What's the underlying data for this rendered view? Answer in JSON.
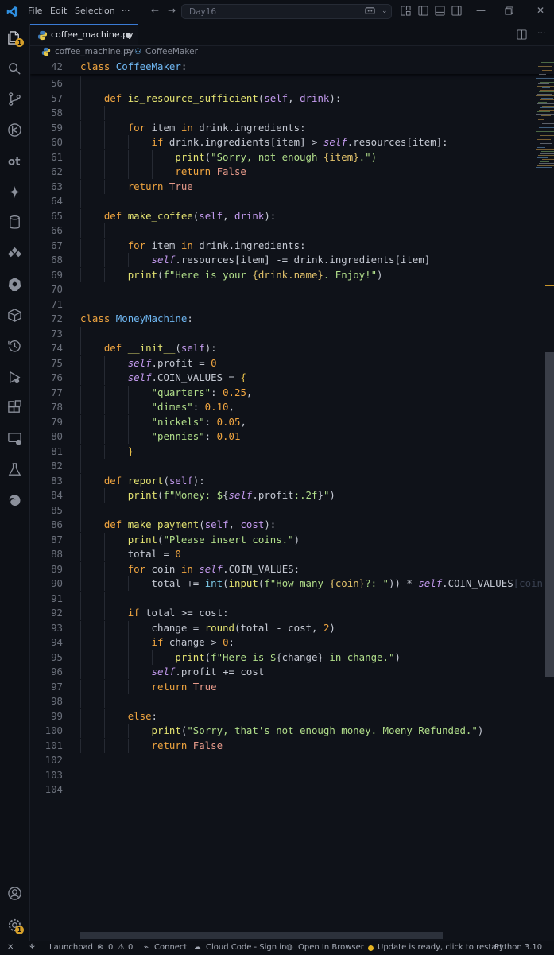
{
  "titlebar": {
    "menu": [
      "File",
      "Edit",
      "Selection"
    ],
    "more": "···",
    "search_text": "Day16"
  },
  "activity_bar": {
    "explorer_badge": "1",
    "manage_badge": "1",
    "icons": [
      "explorer-icon",
      "search-icon",
      "source-control-icon",
      "run-debug-icon",
      "outline-icon",
      "copilot-icon",
      "database-icon",
      "extensions-icon",
      "kubernetes-icon",
      "packages-icon",
      "timeline-icon",
      "deploy-icon",
      "extensions-grid-icon",
      "remote-explorer-icon",
      "testing-icon",
      "edge-icon",
      "account-icon",
      "manage-icon"
    ]
  },
  "tab": {
    "filename": "coffee_machine.py",
    "dirty": true
  },
  "breadcrumb": {
    "file": "coffee_machine.py",
    "symbol": "CoffeeMaker",
    "separator": ">"
  },
  "editor": {
    "sticky_line": "42",
    "sticky_text": {
      "kw": "class",
      "name": "CoffeeMaker",
      "colon": ":"
    },
    "line_numbers": [
      "56",
      "57",
      "58",
      "59",
      "60",
      "61",
      "62",
      "63",
      "64",
      "65",
      "66",
      "67",
      "68",
      "69",
      "70",
      "71",
      "72",
      "73",
      "74",
      "75",
      "76",
      "77",
      "78",
      "79",
      "80",
      "81",
      "82",
      "83",
      "84",
      "85",
      "86",
      "87",
      "88",
      "89",
      "90",
      "91",
      "92",
      "93",
      "94",
      "95",
      "96",
      "97",
      "98",
      "99",
      "100",
      "101",
      "102",
      "103",
      "104"
    ],
    "tokens": {
      "def": "def",
      "class": "class",
      "for": "for",
      "in": "in",
      "if": "if",
      "return": "return",
      "else": "else",
      "self": "self",
      "True": "True",
      "False": "False",
      "print": "print",
      "is_resource_sufficient": "is_resource_sufficient",
      "make_coffee": "make_coffee",
      "MoneyMachine": "MoneyMachine",
      "__init__": "__init__",
      "report": "report",
      "make_payment": "make_payment",
      "int": "int",
      "input": "input",
      "round": "round",
      "drink": "drink",
      "item": "item",
      "ingredients": "ingredients",
      "resources": "resources",
      "profit": "profit",
      "COIN_VALUES": "COIN_VALUES",
      "cost": "cost",
      "total": "total",
      "coin": "coin",
      "change": "change",
      "name": "name",
      "str_sorry": "\"Sorry, not enough ",
      "str_item": "{item}",
      "str_end": ".\")",
      "str_here": "f\"Here is your ",
      "str_drinkname": "{drink.name}",
      "str_enjoy": ". Enjoy!\"",
      "quarters": "\"quarters\"",
      "dimes": "\"dimes\"",
      "nickels": "\"nickels\"",
      "pennies": "\"pennies\"",
      "n025": "0.25",
      "n010": "0.10",
      "n005": "0.05",
      "n001": "0.01",
      "n0": "0",
      "n2": "2",
      "str_money": "f\"Money: $",
      "str_profit_fmt": ":.2f",
      "str_close": "\"",
      "str_insert": "\"Please insert coins.\"",
      "str_howmany": "f\"How many ",
      "str_coin": "{coin}",
      "str_howmany_end": "?: \"",
      "str_here_is": "f\"Here is $",
      "str_change": "change",
      "str_in_change": " in change.\"",
      "str_refund": "\"Sorry, that's not enough money. Moeny Refunded.\"",
      "trail_coin": "[coin"
    }
  },
  "statusbar": {
    "launchpad": "Launchpad",
    "errors": "0",
    "warnings": "0",
    "connect": "Connect",
    "cloud_code": "Cloud Code - Sign in",
    "open_browser": "Open In Browser",
    "update": "Update is ready, click to restart.",
    "python": "Python 3.10"
  },
  "colors": {
    "accent": "#3a7bd5",
    "badge": "#d59f2a",
    "background": "#0f1219"
  }
}
